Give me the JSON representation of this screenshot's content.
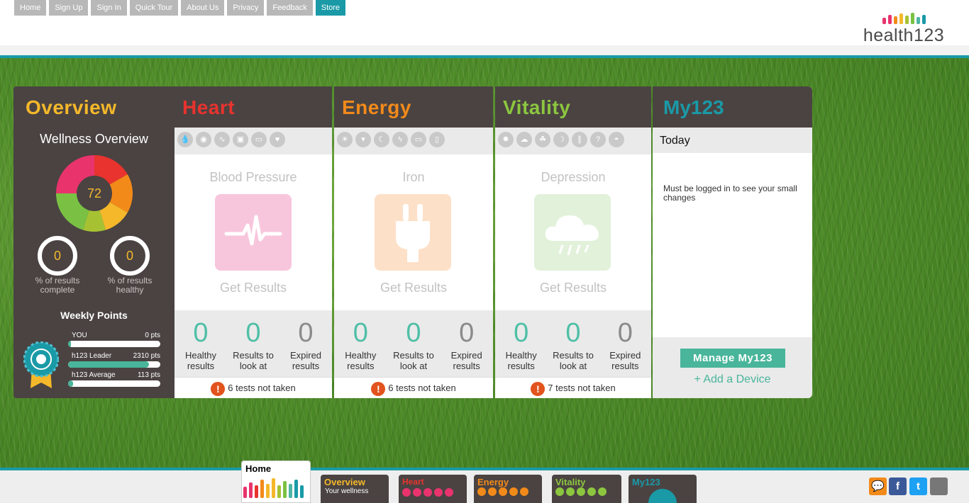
{
  "nav": [
    "Home",
    "Sign Up",
    "Sign In",
    "Quick Tour",
    "About Us",
    "Privacy",
    "Feedback",
    "Store"
  ],
  "logo": {
    "text": "health123",
    "bar_colors": [
      "#e8336d",
      "#e8336d",
      "#f28a1a",
      "#f5b82a",
      "#a6c232",
      "#7ac143",
      "#4fb5a5",
      "#1a9aa7"
    ]
  },
  "overview": {
    "title": "Overview",
    "wellness_title": "Wellness Overview",
    "score": "72",
    "complete": {
      "value": "0",
      "label": "% of results complete"
    },
    "healthy": {
      "value": "0",
      "label": "% of results healthy"
    },
    "weekly_title": "Weekly Points",
    "points": [
      {
        "label": "YOU",
        "value": "0 pts",
        "fraction": 0.0
      },
      {
        "label": "h123 Leader",
        "value": "2310 pts",
        "fraction": 0.88
      },
      {
        "label": "h123 Average",
        "value": "113 pts",
        "fraction": 0.05
      }
    ]
  },
  "cards": [
    {
      "title": "Heart",
      "color": "#e8332e",
      "test": "Blood Pressure",
      "tile_color": "#f8c6dc",
      "get": "Get Results",
      "stats": [
        {
          "n": "0",
          "cap": "Healthy results",
          "c": "#4fbfa6"
        },
        {
          "n": "0",
          "cap": "Results to look at",
          "c": "#4fbfa6"
        },
        {
          "n": "0",
          "cap": "Expired results",
          "c": "#8a8a8a"
        }
      ],
      "footer": "6 tests not taken",
      "icons": [
        "💧",
        "◉",
        "∿",
        "▣",
        "▭",
        "♥"
      ]
    },
    {
      "title": "Energy",
      "color": "#f28a1a",
      "test": "Iron",
      "tile_color": "#fde0c8",
      "get": "Get Results",
      "stats": [
        {
          "n": "0",
          "cap": "Healthy results",
          "c": "#4fbfa6"
        },
        {
          "n": "0",
          "cap": "Results to look at",
          "c": "#4fbfa6"
        },
        {
          "n": "0",
          "cap": "Expired results",
          "c": "#8a8a8a"
        }
      ],
      "footer": "6 tests not taken",
      "icons": [
        "☀",
        "▾",
        "☾",
        "ϟ",
        "▭",
        "▯"
      ]
    },
    {
      "title": "Vitality",
      "color": "#8cc63f",
      "test": "Depression",
      "tile_color": "#e2f1da",
      "get": "Get Results",
      "stats": [
        {
          "n": "0",
          "cap": "Healthy results",
          "c": "#4fbfa6"
        },
        {
          "n": "0",
          "cap": "Results to look at",
          "c": "#4fbfa6"
        },
        {
          "n": "0",
          "cap": "Expired results",
          "c": "#8a8a8a"
        }
      ],
      "footer": "7 tests not taken",
      "icons": [
        "✹",
        "☁",
        "☘",
        "☽",
        "∥",
        "?",
        "◓"
      ]
    }
  ],
  "my123": {
    "title": "My123",
    "today": "Today",
    "message": "Must be logged in to see your small changes",
    "manage": "Manage My123",
    "add": "+ Add a Device"
  },
  "bottom_tabs": [
    {
      "title": "Home",
      "color": "#222222"
    },
    {
      "title": "Overview",
      "sub": "Your wellness",
      "color": "#f5b82a"
    },
    {
      "title": "Heart",
      "color": "#e8332e"
    },
    {
      "title": "Energy",
      "color": "#f28a1a"
    },
    {
      "title": "Vitality",
      "color": "#8cc63f"
    },
    {
      "title": "My123",
      "color": "#1a9aa7"
    }
  ],
  "social": [
    {
      "icon": "chat-icon",
      "glyph": "💬",
      "color": "#f28a1a"
    },
    {
      "icon": "facebook-icon",
      "glyph": "f",
      "color": "#3b5998"
    },
    {
      "icon": "twitter-icon",
      "glyph": "t",
      "color": "#1da1f2"
    },
    {
      "icon": "apple-icon",
      "glyph": "",
      "color": "#777777"
    }
  ]
}
